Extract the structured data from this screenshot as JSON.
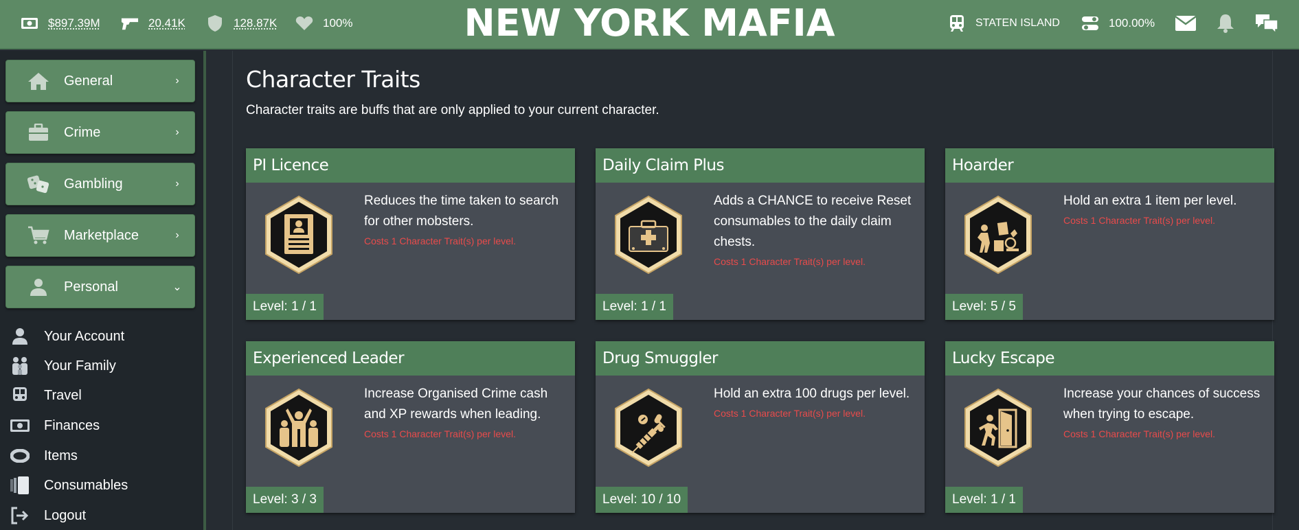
{
  "header": {
    "brand": "NEW YORK MAFIA",
    "cash": "$897.39M",
    "bullets": "20.41K",
    "defense": "128.87K",
    "health": "100%",
    "location": "STATEN ISLAND",
    "progress": "100.00%",
    "icons": [
      "cash-icon",
      "gun-icon",
      "shield-icon",
      "heart-icon",
      "train-icon",
      "toggle-icon",
      "mail-icon",
      "bell-icon",
      "chat-icon"
    ]
  },
  "sidebar": {
    "menus": [
      {
        "label": "General",
        "chevron": "›",
        "icon": "home-icon"
      },
      {
        "label": "Crime",
        "chevron": "›",
        "icon": "briefcase-icon"
      },
      {
        "label": "Gambling",
        "chevron": "›",
        "icon": "dice-icon"
      },
      {
        "label": "Marketplace",
        "chevron": "›",
        "icon": "cart-icon"
      },
      {
        "label": "Personal",
        "chevron": "⌄",
        "icon": "user-icon"
      }
    ],
    "personal_items": [
      {
        "label": "Your Account",
        "icon": "user-icon"
      },
      {
        "label": "Your Family",
        "icon": "family-icon"
      },
      {
        "label": "Travel",
        "icon": "train-icon"
      },
      {
        "label": "Finances",
        "icon": "cash-icon"
      },
      {
        "label": "Items",
        "icon": "ring-icon"
      },
      {
        "label": "Consumables",
        "icon": "cards-icon"
      },
      {
        "label": "Logout",
        "icon": "logout-icon"
      }
    ]
  },
  "main": {
    "title": "Character Traits",
    "subtitle": "Character traits are buffs that are only applied to your current character.",
    "traits": [
      {
        "name": "PI Licence",
        "description": "Reduces the time taken to search for other mobsters.",
        "cost": "Costs 1 Character Trait(s) per level.",
        "level": "Level: 1 / 1",
        "icon": "id-card-icon"
      },
      {
        "name": "Daily Claim Plus",
        "description": "Adds a CHANCE to receive Reset consumables to the daily claim chests.",
        "cost": "Costs 1 Character Trait(s) per level.",
        "level": "Level: 1 / 1",
        "icon": "medkit-icon"
      },
      {
        "name": "Hoarder",
        "description": "Hold an extra 1 item per level.",
        "cost": "Costs 1 Character Trait(s) per level.",
        "level": "Level: 5 / 5",
        "icon": "hoarder-icon"
      },
      {
        "name": "Experienced Leader",
        "description": "Increase Organised Crime cash and XP rewards when leading.",
        "cost": "Costs 1 Character Trait(s) per level.",
        "level": "Level: 3 / 3",
        "icon": "group-icon"
      },
      {
        "name": "Drug Smuggler",
        "description": "Hold an extra 100 drugs per level.",
        "cost": "Costs 1 Character Trait(s) per level.",
        "level": "Level: 10 / 10",
        "icon": "syringe-icon"
      },
      {
        "name": "Lucky Escape",
        "description": "Increase your chances of success when trying to escape.",
        "cost": "Costs 1 Character Trait(s) per level.",
        "level": "Level: 1 / 1",
        "icon": "exit-door-icon"
      }
    ]
  },
  "colors": {
    "accent_green": "#5d8a65",
    "card_header": "#4f7f59",
    "card_body": "#474c54",
    "cost_red": "#e94b4b",
    "badge_gold": "#e8cf9a"
  }
}
